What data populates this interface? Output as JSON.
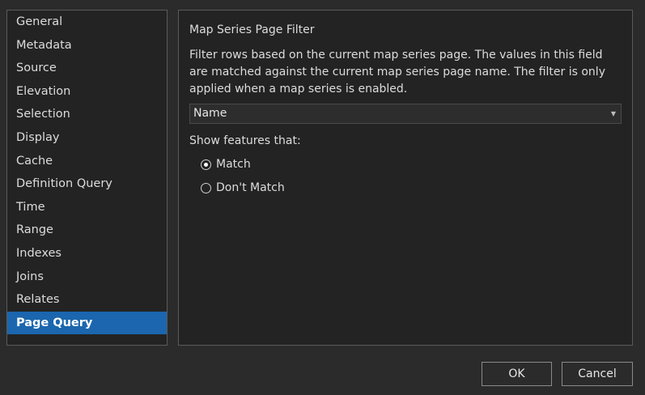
{
  "sidebar": {
    "items": [
      {
        "label": "General"
      },
      {
        "label": "Metadata"
      },
      {
        "label": "Source"
      },
      {
        "label": "Elevation"
      },
      {
        "label": "Selection"
      },
      {
        "label": "Display"
      },
      {
        "label": "Cache"
      },
      {
        "label": "Definition Query"
      },
      {
        "label": "Time"
      },
      {
        "label": "Range"
      },
      {
        "label": "Indexes"
      },
      {
        "label": "Joins"
      },
      {
        "label": "Relates"
      },
      {
        "label": "Page Query"
      }
    ],
    "active": "Page Query"
  },
  "main": {
    "section_title": "Map Series Page Filter",
    "description": "Filter rows based on the current map series page. The values in this field are matched against the current map series page name. The filter is only applied when a map series is enabled.",
    "field_select": {
      "value": "Name"
    },
    "show_label": "Show features that:",
    "radios": [
      {
        "label": "Match",
        "selected": true
      },
      {
        "label": "Don't Match",
        "selected": false
      }
    ]
  },
  "buttons": {
    "ok": "OK",
    "cancel": "Cancel"
  },
  "colors": {
    "accent": "#1b66ae",
    "panel": "#232323",
    "background": "#2b2b2b"
  },
  "icons": {
    "dropdown": "chevron-down-icon",
    "radio_on": "radio-selected-icon",
    "radio_off": "radio-unselected-icon"
  }
}
